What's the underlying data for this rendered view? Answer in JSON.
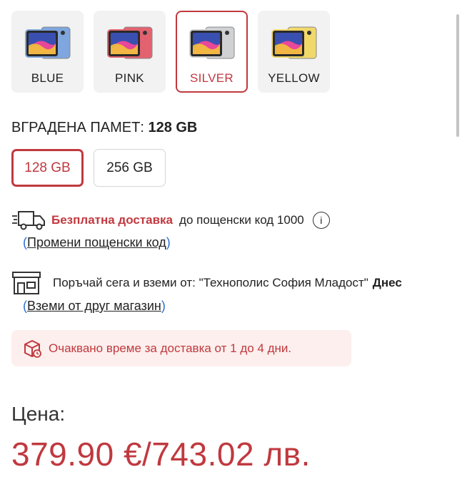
{
  "colors": [
    {
      "label": "BLUE",
      "swatch": "#7fa6de",
      "active": false
    },
    {
      "label": "PINK",
      "swatch": "#e3626f",
      "active": false
    },
    {
      "label": "SILVER",
      "swatch": "#cfd1d3",
      "active": true
    },
    {
      "label": "YELLOW",
      "swatch": "#f1d86a",
      "active": false
    }
  ],
  "memory": {
    "heading_prefix": "ВГРАДЕНА ПАМЕТ:",
    "heading_value": "128 GB",
    "options": [
      {
        "label": "128 GB",
        "active": true
      },
      {
        "label": "256 GB",
        "active": false
      }
    ]
  },
  "delivery": {
    "free_label": "Безплатна доставка",
    "postcode_text": "до пощенски код 1000",
    "info_icon": "i",
    "change_link_open": "(",
    "change_link": "Промени пощенски код",
    "change_link_close": ")"
  },
  "pickup": {
    "text": "Поръчай сега и вземи от:  \"Технополис София Младост\"",
    "when": "Днес",
    "other_link_open": "(",
    "other_link": "Вземи от друг магазин",
    "other_link_close": ")"
  },
  "notice": {
    "text": "Очаквано време за доставка от 1 до 4 дни."
  },
  "price": {
    "label": "Цена:",
    "value": "379.90 €/743.02 лв."
  },
  "theme": {
    "accent": "#c0393f",
    "link": "#2a6fcf",
    "notice_bg": "#fcefed"
  },
  "icons": [
    "truck-icon",
    "store-icon",
    "box-icon",
    "info-icon",
    "tablet-icon"
  ]
}
